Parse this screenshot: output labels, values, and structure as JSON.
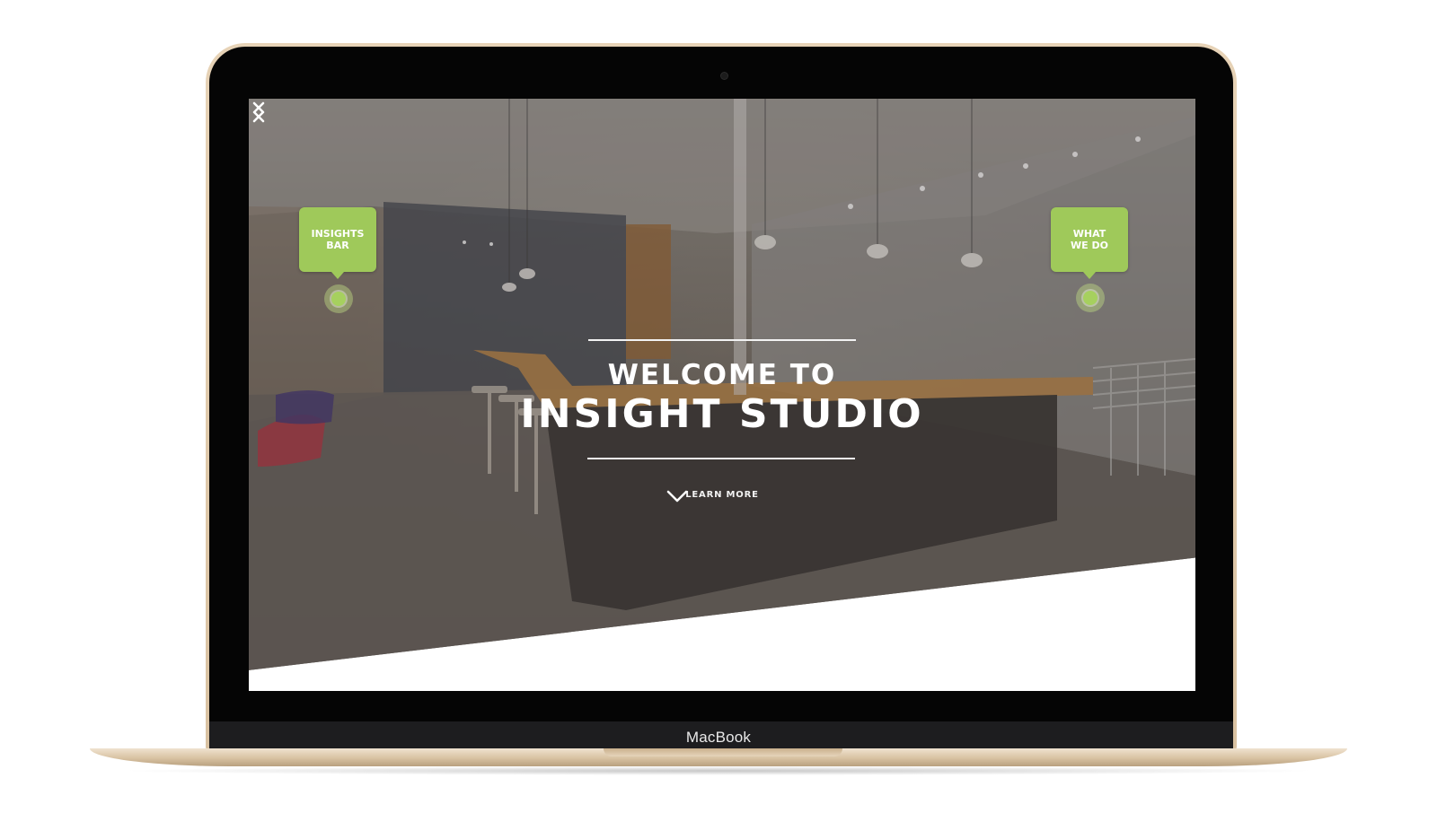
{
  "device": {
    "brand_label": "MacBook"
  },
  "hero": {
    "welcome_line": "WELCOME TO",
    "title": "INSIGHT STUDIO",
    "learn_more_label": "LEARN MORE"
  },
  "hotspots": {
    "left": {
      "label_line1": "INSIGHTS",
      "label_line2": "BAR"
    },
    "right": {
      "label_line1": "WHAT",
      "label_line2": "WE DO"
    }
  },
  "icons": {
    "learn_more": "chevron-down-icon",
    "prev": "chevron-left-icon",
    "next": "chevron-right-icon"
  },
  "colors": {
    "accent_green": "#9fc95a",
    "laptop_gold": "#e7d3b7",
    "bezel": "#050505"
  }
}
